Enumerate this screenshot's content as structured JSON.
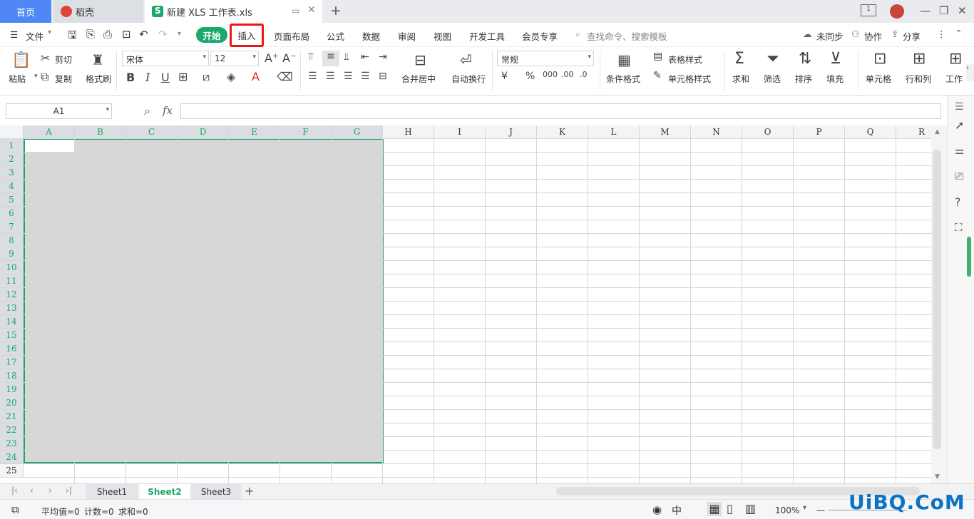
{
  "titlebar": {
    "tab_home": "首页",
    "tab_daoke": "稻壳",
    "tab_file": "新建 XLS 工作表.xls",
    "new_tab": "+",
    "badge_count": "1"
  },
  "menubar": {
    "file": "文件",
    "start": "开始",
    "insert": "插入",
    "page_layout": "页面布局",
    "formula": "公式",
    "data": "数据",
    "review": "审阅",
    "view": "视图",
    "developer": "开发工具",
    "member": "会员专享",
    "search_placeholder": "查找命令、搜索模板",
    "sync": "未同步",
    "collab": "协作",
    "share": "分享"
  },
  "ribbon": {
    "paste": "粘贴",
    "cut": "剪切",
    "copy": "复制",
    "format_painter": "格式刷",
    "font_name": "宋体",
    "font_size": "12",
    "merge_center": "合并居中",
    "wrap_text": "自动换行",
    "number_format": "常规",
    "conditional_format": "条件格式",
    "table_style": "表格样式",
    "cell_style": "单元格样式",
    "sum": "求和",
    "filter": "筛选",
    "sort": "排序",
    "fill": "填充",
    "cell": "单元格",
    "row_col": "行和列",
    "worksheet": "工作"
  },
  "formulabar": {
    "name_box": "A1",
    "fx": "fx"
  },
  "sheet": {
    "columns": [
      "A",
      "B",
      "C",
      "D",
      "E",
      "F",
      "G",
      "H",
      "I",
      "J",
      "K",
      "L",
      "M",
      "N",
      "O",
      "P",
      "Q",
      "R"
    ],
    "rows": [
      "1",
      "2",
      "3",
      "4",
      "5",
      "6",
      "7",
      "8",
      "9",
      "10",
      "11",
      "12",
      "13",
      "14",
      "15",
      "16",
      "17",
      "18",
      "19",
      "20",
      "21",
      "22",
      "23",
      "24",
      "25"
    ]
  },
  "sheettabs": {
    "tabs": [
      "Sheet1",
      "Sheet2",
      "Sheet3"
    ],
    "active": "Sheet2"
  },
  "statusbar": {
    "average": "平均值=0",
    "count": "计数=0",
    "sum": "求和=0",
    "zoom": "100%"
  },
  "watermark": "UiBQ.CoM",
  "colors": {
    "accent": "#1aa86b",
    "home_tab": "#4f88f5",
    "highlight_box": "#f01414"
  }
}
